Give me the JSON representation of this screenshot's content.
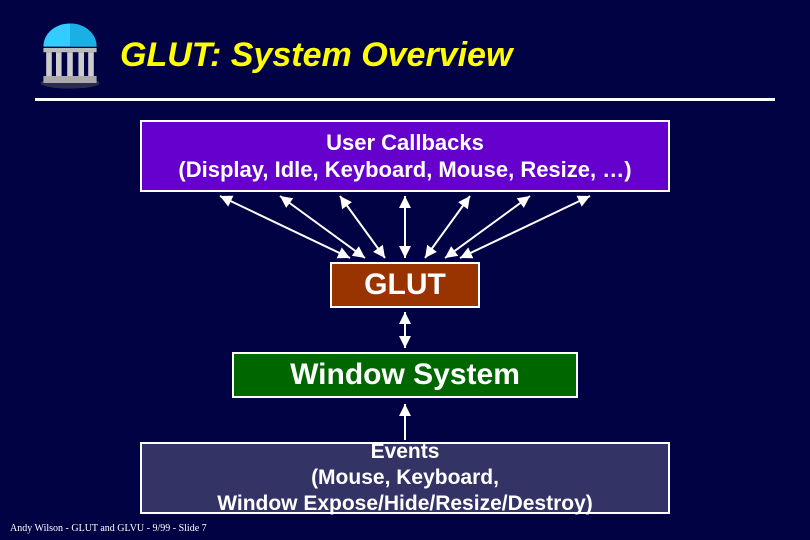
{
  "header": {
    "title": "GLUT: System Overview",
    "logo_name": "pavilion-icon"
  },
  "boxes": {
    "callbacks": {
      "line1": "User Callbacks",
      "line2": "(Display, Idle, Keyboard, Mouse, Resize, …)"
    },
    "glut": "GLUT",
    "window": "Window System",
    "events": {
      "line1": "Events",
      "line2": "(Mouse, Keyboard,",
      "line3": "Window Expose/Hide/Resize/Destroy)"
    }
  },
  "footer": "Andy Wilson - GLUT and GLVU - 9/99 - Slide 7"
}
